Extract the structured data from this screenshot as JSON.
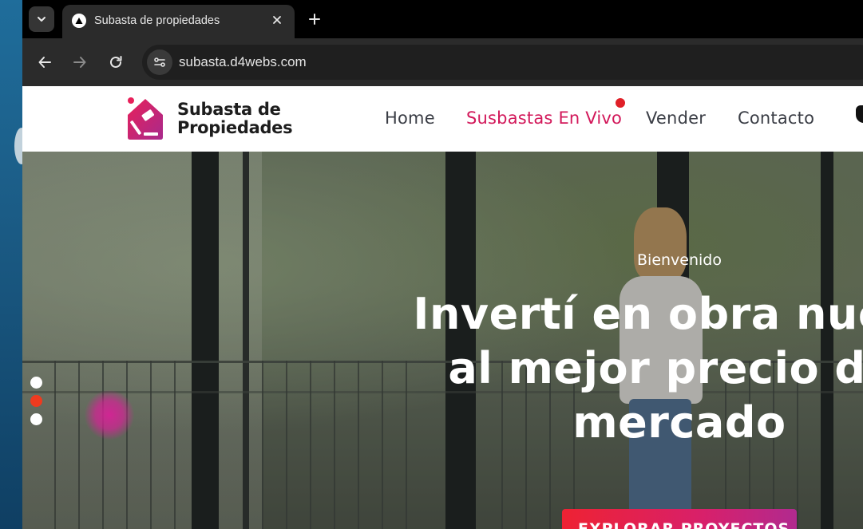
{
  "browser": {
    "tab_title": "Subasta de propiedades",
    "url": "subasta.d4webs.com"
  },
  "site": {
    "logo_line1": "Subasta de",
    "logo_line2": "Propiedades",
    "nav": [
      {
        "label": "Home",
        "active": false
      },
      {
        "label": "Susbastas En Vivo",
        "active": true
      },
      {
        "label": "Vender",
        "active": false
      },
      {
        "label": "Contacto",
        "active": false
      }
    ],
    "brand_color": "#d2185a",
    "live_indicator_color": "#e02028"
  },
  "hero": {
    "eyebrow": "Bienvenido",
    "title": "Invertí en obra nueva\nal mejor precio del\nmercado",
    "cta_label": "EXPLORAR PROYECTOS",
    "slide_index": 2,
    "slide_count": 3
  }
}
